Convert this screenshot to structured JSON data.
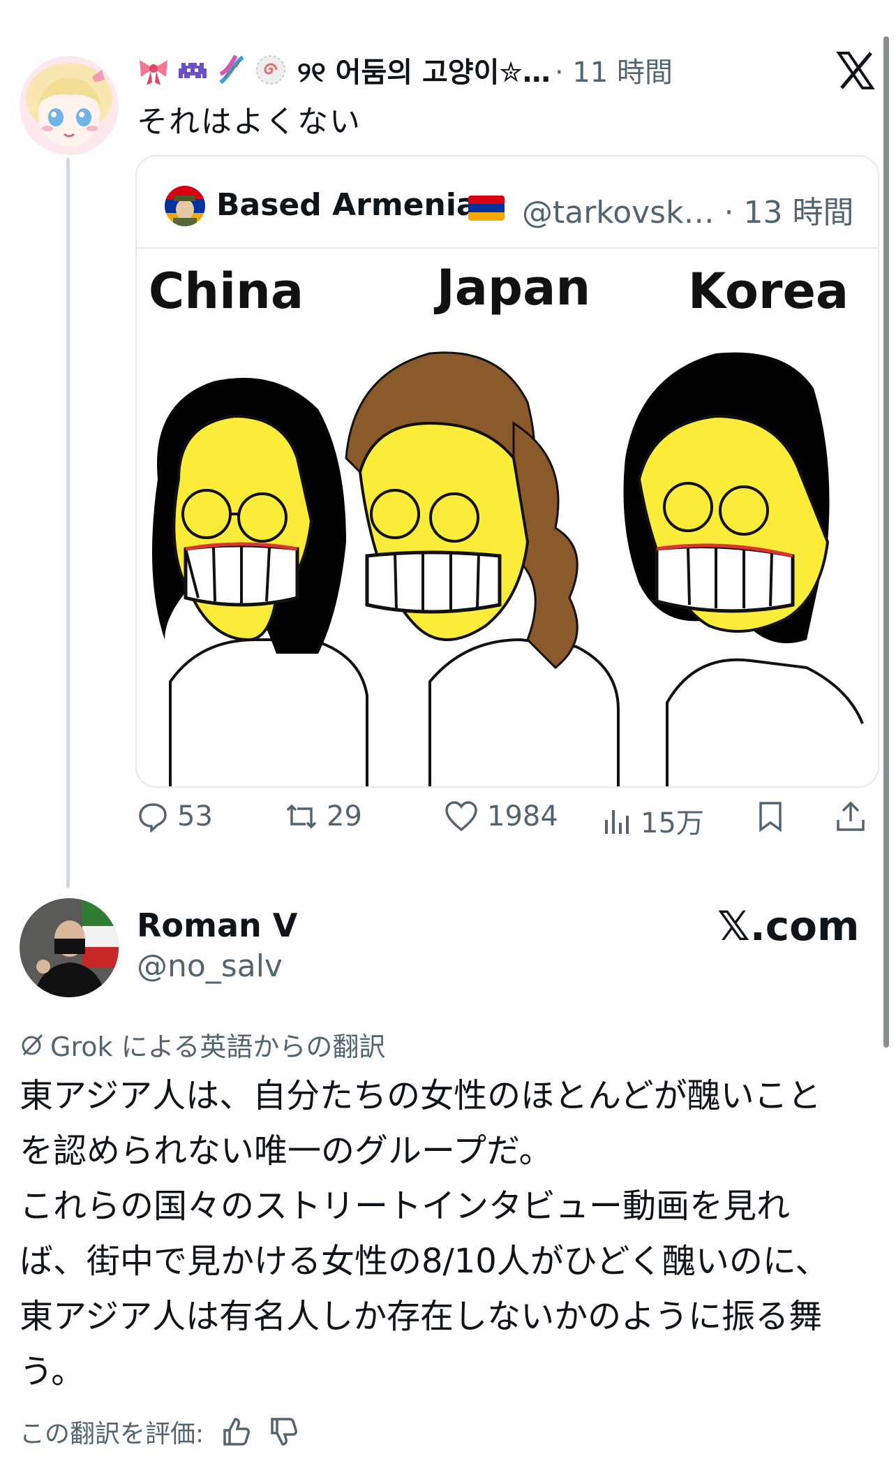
{
  "tweet1": {
    "emoji_icons": [
      "ribbon-icon",
      "space-invader-icon",
      "dna-icon",
      "spiral-candy-icon"
    ],
    "display_name": "୨୧ 어둠의 고양이✮…",
    "time": "· 11 時間",
    "text": "それはよくない"
  },
  "quote": {
    "display_name": "Based Armenia",
    "flag": "armenia-flag-icon",
    "handle_time": "@tarkovsk… · 13 時間",
    "image_labels": [
      "China",
      "Japan",
      "Korea"
    ]
  },
  "actions": {
    "replies": "53",
    "reposts": "29",
    "likes": "1984",
    "views": "15万"
  },
  "tweet2": {
    "display_name": "Roman V",
    "handle": "@no_salv",
    "watermark": "𝕏.com",
    "grok_label": "Grok による英語からの翻訳",
    "translation": "東アジア人は、自分たちの女性のほとんどが醜いこと\nを認められない唯一のグループだ。\nこれらの国々のストリートインタビュー動画を見れ\nば、街中で見かける女性の8/10人がひどく醜いのに、\n東アジア人は有名人しか存在しないかのように振る舞\nう。",
    "rate_label": "この翻訳を評価:"
  },
  "colors": {
    "text": "#0f1419",
    "secondary": "#536471",
    "border": "#e6eaed",
    "meme_yellow": "#fcec3a"
  }
}
